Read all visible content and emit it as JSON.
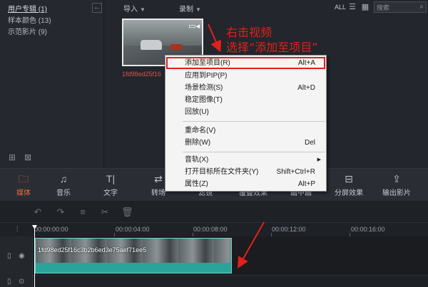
{
  "library": {
    "folders": [
      {
        "label": "用户专辑 (1)",
        "active": true
      },
      {
        "label": "样本颜色 (13)",
        "active": false
      },
      {
        "label": "示范影片 (9)",
        "active": false
      }
    ],
    "toolbar": {
      "import_label": "导入",
      "record_label": "录制",
      "all_label": "ALL",
      "search_placeholder": "搜索"
    },
    "clip_name": "1fd98ed25f16"
  },
  "context_menu": {
    "items": [
      {
        "label": "添加至项目(R)",
        "shortcut": "Alt+A",
        "highlighted": true
      },
      {
        "label": "应用到PIP(P)",
        "shortcut": ""
      },
      {
        "label": "场景检测(S)",
        "shortcut": "Alt+D"
      },
      {
        "label": "稳定图像(T)",
        "shortcut": ""
      },
      {
        "label": "回放(U)",
        "shortcut": ""
      },
      {
        "label": "重命名(V)",
        "shortcut": ""
      },
      {
        "label": "删除(W)",
        "shortcut": "Del"
      },
      {
        "label": "音轨(X)",
        "shortcut": ""
      },
      {
        "label": "打开目标所在文件夹(Y)",
        "shortcut": "Shift+Ctrl+R"
      },
      {
        "label": "属性(Z)",
        "shortcut": "Alt+P"
      }
    ]
  },
  "annotation": {
    "line1": "右击视频",
    "line2": "选择“添加至项目”",
    "color": "#e0211b"
  },
  "tools": [
    {
      "label": "媒体",
      "icon": "folder-icon",
      "active": true
    },
    {
      "label": "音乐",
      "icon": "music-note-icon",
      "active": false
    },
    {
      "label": "文字",
      "icon": "text-icon",
      "active": false
    },
    {
      "label": "转场",
      "icon": "transition-icon",
      "active": false
    },
    {
      "label": "滤镜",
      "icon": "filter-icon",
      "active": false
    },
    {
      "label": "覆叠效果",
      "icon": "overlay-icon",
      "active": false
    },
    {
      "label": "画中画",
      "icon": "pip-icon",
      "active": false
    },
    {
      "label": "分屏效果",
      "icon": "split-screen-icon",
      "active": false
    },
    {
      "label": "输出影片",
      "icon": "export-icon",
      "active": false
    }
  ],
  "timeline": {
    "ruler": [
      "00:00:00:00",
      "00:00:04:00",
      "00:00:08:00",
      "00:00:12:00",
      "00:00:16:00"
    ],
    "clip_label": "1fd98ed25f16c3b2b6ed3e75aef71ee5"
  },
  "colors": {
    "accent": "#ef6a3a",
    "clip": "#2aa39a",
    "highlight_border": "#e0211b"
  }
}
